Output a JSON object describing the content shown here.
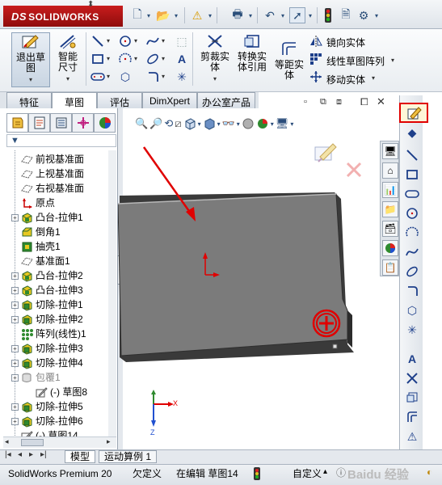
{
  "app": {
    "logo": "SOLIDWORKS",
    "logo_mark": "DS"
  },
  "command_manager": {
    "exit_sketch": "退出草图",
    "smart_dimension": "智能尺寸",
    "trim": "剪裁实体",
    "convert": "转换实体引用",
    "offset": "等距实体",
    "mirror": "镜向实体",
    "linear_pattern": "线性草图阵列",
    "move": "移动实体"
  },
  "tabs": [
    {
      "label": "特征"
    },
    {
      "label": "草图"
    },
    {
      "label": "评估"
    },
    {
      "label": "DimXpert"
    },
    {
      "label": "办公室产品"
    }
  ],
  "active_tab": "草图",
  "feature_tree": [
    {
      "label": "前视基准面",
      "icon": "plane-icon",
      "expand": false
    },
    {
      "label": "上视基准面",
      "icon": "plane-icon",
      "expand": false
    },
    {
      "label": "右视基准面",
      "icon": "plane-icon",
      "expand": false
    },
    {
      "label": "原点",
      "icon": "origin-icon",
      "expand": false
    },
    {
      "label": "凸台-拉伸1",
      "icon": "boss-extrude-icon",
      "expand": true
    },
    {
      "label": "倒角1",
      "icon": "chamfer-icon",
      "expand": false
    },
    {
      "label": "抽壳1",
      "icon": "shell-icon",
      "expand": false
    },
    {
      "label": "基准面1",
      "icon": "plane-icon",
      "expand": false
    },
    {
      "label": "凸台-拉伸2",
      "icon": "boss-extrude-icon",
      "expand": true
    },
    {
      "label": "凸台-拉伸3",
      "icon": "boss-extrude-icon",
      "expand": true
    },
    {
      "label": "切除-拉伸1",
      "icon": "cut-extrude-icon",
      "expand": true
    },
    {
      "label": "切除-拉伸2",
      "icon": "cut-extrude-icon",
      "expand": true
    },
    {
      "label": "阵列(线性)1",
      "icon": "linear-pattern-icon",
      "expand": false
    },
    {
      "label": "切除-拉伸3",
      "icon": "cut-extrude-icon",
      "expand": true
    },
    {
      "label": "切除-拉伸4",
      "icon": "cut-extrude-icon",
      "expand": true
    },
    {
      "label": "包覆1",
      "icon": "wrap-icon",
      "expand": true,
      "dim": true
    },
    {
      "label": "(-) 草图8",
      "icon": "sketch-icon",
      "expand": false,
      "child": true
    },
    {
      "label": "切除-拉伸5",
      "icon": "cut-extrude-icon",
      "expand": true
    },
    {
      "label": "切除-拉伸6",
      "icon": "cut-extrude-icon",
      "expand": true
    },
    {
      "label": "(-) 草图14",
      "icon": "sketch-icon",
      "expand": false
    }
  ],
  "bottom_tabs": [
    {
      "label": "模型"
    },
    {
      "label": "运动算例 1"
    }
  ],
  "status": {
    "product": "SolidWorks Premium 20",
    "definition": "欠定义",
    "editing": "在编辑 草图14",
    "custom": "自定义"
  },
  "watermark": "Baidu 经验",
  "colors": {
    "brand_red": "#c81d1d",
    "highlight_red": "#e00000",
    "plate_gray": "#7b7b7b",
    "tree_yellow": "#e8c820",
    "tree_green": "#2f8a2f"
  }
}
